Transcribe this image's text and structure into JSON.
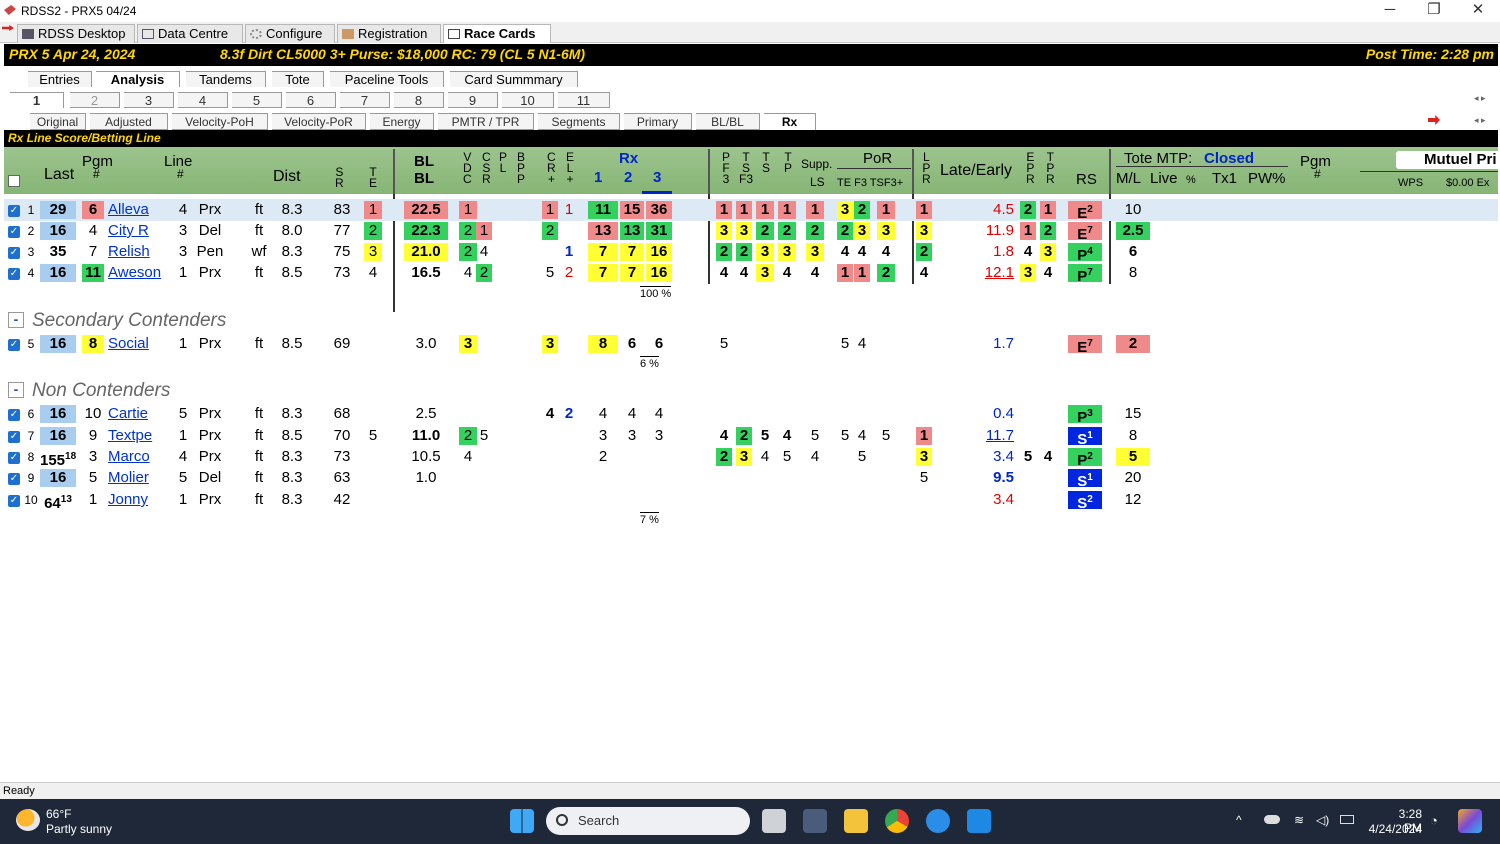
{
  "window": {
    "title": "RDSS2 - PRX5  04/24",
    "min": "─",
    "max": "❐",
    "close": "✕"
  },
  "app_tabs": [
    "RDSS Desktop",
    "Data Centre",
    "Configure",
    "Registration",
    "Race Cards"
  ],
  "header": {
    "race": "PRX  5  Apr 24, 2024",
    "conditions": "8.3f  Dirt   CL5000  3+   Purse: $18,000   RC: 79  (CL 5 N1-6M)",
    "post_time": "Post Time: 2:28 pm"
  },
  "view_tabs": [
    "Entries",
    "Analysis",
    "Tandems",
    "Tote",
    "Paceline Tools",
    "Card Summmary"
  ],
  "race_tabs": [
    "1",
    "2",
    "3",
    "4",
    "5",
    "6",
    "7",
    "8",
    "9",
    "10",
    "11"
  ],
  "sub_tabs": [
    "Original",
    "Adjusted",
    "Velocity-PoH",
    "Velocity-PoR",
    "Energy",
    "PMTR / TPR",
    "Segments",
    "Primary",
    "BL/BL",
    "Rx"
  ],
  "section_bar": "Rx Line Score/Betting Line",
  "columns": {
    "last": "Last",
    "pgm": "Pgm",
    "pgm_hash": "#",
    "line": "Line",
    "line_hash": "#",
    "dist": "Dist",
    "sr": "S\nR",
    "te": "T\nE",
    "bl": "BL",
    "bl2": "BL",
    "vdc": "V\nD\nC",
    "csr": "C\nS\nR",
    "pl": "P\nL",
    "bpp": "B\nP\nP",
    "cr": "C\nR\n+",
    "el": "E\nL\n+",
    "rx": "Rx",
    "rx1": "1",
    "rx2": "2",
    "rx3": "3",
    "pf3": "P\nF\n3",
    "tsf3": "T\nS\nF3",
    "ts": "T\nS",
    "tp": "T\nP",
    "supp": "Supp.",
    "ls": "LS",
    "por": "PoR",
    "te_f3": "TE F3 TSF3+",
    "lpr": "L\nP\nR",
    "late_early": "Late/Early",
    "epr": "E\nP\nR",
    "tpr": "T\nP\nR",
    "rs": "RS",
    "tote_mtp": "Tote MTP:",
    "tote_status": "Closed",
    "ml": "M/L",
    "live": "Live",
    "live_pct": "%",
    "tx1": "Tx1",
    "pw": "PW%",
    "pgm2": "Pgm",
    "pgm2_hash": "#",
    "mutuel": "Mutuel Pri",
    "wps": "WPS",
    "ex": "$0.00 Ex"
  },
  "contenders": [
    {
      "n": "1",
      "last": "29",
      "pgm": "6",
      "name": "Alleva",
      "line": "4",
      "trk": "Prx",
      "sfc": "ft",
      "dist": "8.3",
      "sr": "83",
      "te": "1",
      "bl": "22.5",
      "vdc": "1",
      "csr": "",
      "cr": "1",
      "el": "1",
      "rx1": "11",
      "rx2": "15",
      "rx3": "36",
      "pf3": "1",
      "tsf3": "1",
      "ts": "1",
      "tp": "1",
      "supp": "1",
      "por1": "3",
      "por2": "2",
      "por3": "1",
      "lpr": "1",
      "late": "4.5",
      "epr": "2",
      "tpr": "1",
      "rs": "E",
      "rs_sup": "2",
      "ml": "10"
    },
    {
      "n": "2",
      "last": "16",
      "pgm": "4",
      "name": "City R",
      "line": "3",
      "trk": "Del",
      "sfc": "ft",
      "dist": "8.0",
      "sr": "77",
      "te": "2",
      "bl": "22.3",
      "vdc": "2",
      "csr": "1",
      "cr": "2",
      "el": "",
      "rx1": "13",
      "rx2": "13",
      "rx3": "31",
      "pf3": "3",
      "tsf3": "3",
      "ts": "2",
      "tp": "2",
      "supp": "2",
      "por1": "2",
      "por2": "3",
      "por3": "3",
      "lpr": "3",
      "late": "11.9",
      "epr": "1",
      "tpr": "2",
      "rs": "E",
      "rs_sup": "7",
      "ml": "2.5"
    },
    {
      "n": "3",
      "last": "35",
      "pgm": "7",
      "name": "Relish",
      "line": "3",
      "trk": "Pen",
      "sfc": "wf",
      "dist": "8.3",
      "sr": "75",
      "te": "3",
      "bl": "21.0",
      "vdc": "2",
      "csr": "4",
      "cr": "",
      "el": "1",
      "rx1": "7",
      "rx2": "7",
      "rx3": "16",
      "pf3": "2",
      "tsf3": "2",
      "ts": "3",
      "tp": "3",
      "supp": "3",
      "por1": "4",
      "por2": "4",
      "por3": "4",
      "lpr": "2",
      "late": "1.8",
      "epr": "4",
      "tpr": "3",
      "rs": "P",
      "rs_sup": "4",
      "ml": "6"
    },
    {
      "n": "4",
      "last": "16",
      "pgm": "11",
      "name": "Aweson",
      "line": "1",
      "trk": "Prx",
      "sfc": "ft",
      "dist": "8.5",
      "sr": "73",
      "te": "4",
      "bl": "16.5",
      "vdc": "4",
      "csr": "2",
      "cr": "5",
      "el": "2",
      "rx1": "7",
      "rx2": "7",
      "rx3": "16",
      "pf3": "4",
      "tsf3": "4",
      "ts": "3",
      "tp": "4",
      "supp": "4",
      "por1": "1",
      "por2": "1",
      "por3": "2",
      "lpr": "4",
      "late": "12.1",
      "epr": "3",
      "tpr": "4",
      "rs": "P",
      "rs_sup": "7",
      "ml": "8"
    }
  ],
  "contenders_pct": "100 %",
  "secondary_title": "Secondary Contenders",
  "secondary": [
    {
      "n": "5",
      "last": "16",
      "pgm": "8",
      "name": "Social",
      "line": "1",
      "trk": "Prx",
      "sfc": "ft",
      "dist": "8.5",
      "sr": "69",
      "bl": "3.0",
      "vdc": "3",
      "cr": "3",
      "rx1": "8",
      "rx2": "6",
      "rx3": "6",
      "pf3": "5",
      "por1": "5",
      "por2": "4",
      "late": "1.7",
      "rs": "E",
      "rs_sup": "7",
      "ml": "2"
    }
  ],
  "secondary_pct": "6 %",
  "non_title": "Non Contenders",
  "non": [
    {
      "n": "6",
      "last": "16",
      "pgm": "10",
      "name": "Cartie",
      "line": "5",
      "trk": "Prx",
      "sfc": "ft",
      "dist": "8.3",
      "sr": "68",
      "te": "",
      "bl": "2.5",
      "vdc": "",
      "csr": "",
      "cr": "4",
      "el": "2",
      "rx1": "4",
      "rx2": "4",
      "rx3": "4",
      "pf3": "",
      "tsf3": "",
      "ts": "",
      "tp": "",
      "supp": "",
      "por1": "",
      "por2": "",
      "por3": "",
      "lpr": "",
      "late": "0.4",
      "rs": "P",
      "rs_sup": "3",
      "ml": "15"
    },
    {
      "n": "7",
      "last": "16",
      "pgm": "9",
      "name": "Textpe",
      "line": "1",
      "trk": "Prx",
      "sfc": "ft",
      "dist": "8.5",
      "sr": "70",
      "te": "5",
      "bl": "11.0",
      "vdc": "2",
      "csr": "5",
      "cr": "",
      "el": "",
      "rx1": "3",
      "rx2": "3",
      "rx3": "3",
      "pf3": "4",
      "tsf3": "2",
      "ts": "5",
      "tp": "4",
      "supp": "5",
      "por1": "5",
      "por2": "4",
      "por3": "5",
      "lpr": "1",
      "late": "11.7",
      "rs": "S",
      "rs_sup": "1",
      "ml": "8"
    },
    {
      "n": "8",
      "last": "155",
      "last_sup": "18",
      "pgm": "3",
      "name": "Marco",
      "line": "4",
      "trk": "Prx",
      "sfc": "ft",
      "dist": "8.3",
      "sr": "73",
      "te": "",
      "bl": "10.5",
      "vdc": "4",
      "csr": "",
      "cr": "",
      "el": "",
      "rx1": "2",
      "rx2": "",
      "rx3": "",
      "pf3": "2",
      "tsf3": "3",
      "ts": "4",
      "tp": "5",
      "supp": "4",
      "por1": "",
      "por2": "5",
      "por3": "",
      "lpr": "3",
      "late": "3.4",
      "epr": "5",
      "tpr": "4",
      "rs": "P",
      "rs_sup": "2",
      "ml": "5"
    },
    {
      "n": "9",
      "last": "16",
      "pgm": "5",
      "name": "Molier",
      "line": "5",
      "trk": "Del",
      "sfc": "ft",
      "dist": "8.3",
      "sr": "63",
      "te": "",
      "bl": "1.0",
      "lpr": "5",
      "late": "9.5",
      "rs": "S",
      "rs_sup": "1",
      "ml": "20"
    },
    {
      "n": "10",
      "last": "64",
      "last_sup": "13",
      "pgm": "1",
      "name": "Jonny",
      "line": "1",
      "trk": "Prx",
      "sfc": "ft",
      "dist": "8.3",
      "sr": "42",
      "late": "3.4",
      "rs": "S",
      "rs_sup": "2",
      "ml": "12"
    }
  ],
  "non_pct": "7 %",
  "status": "Ready",
  "taskbar": {
    "temp": "66°F",
    "weather": "Partly sunny",
    "search": "Search",
    "time": "3:28 PM",
    "date": "4/24/2024"
  }
}
